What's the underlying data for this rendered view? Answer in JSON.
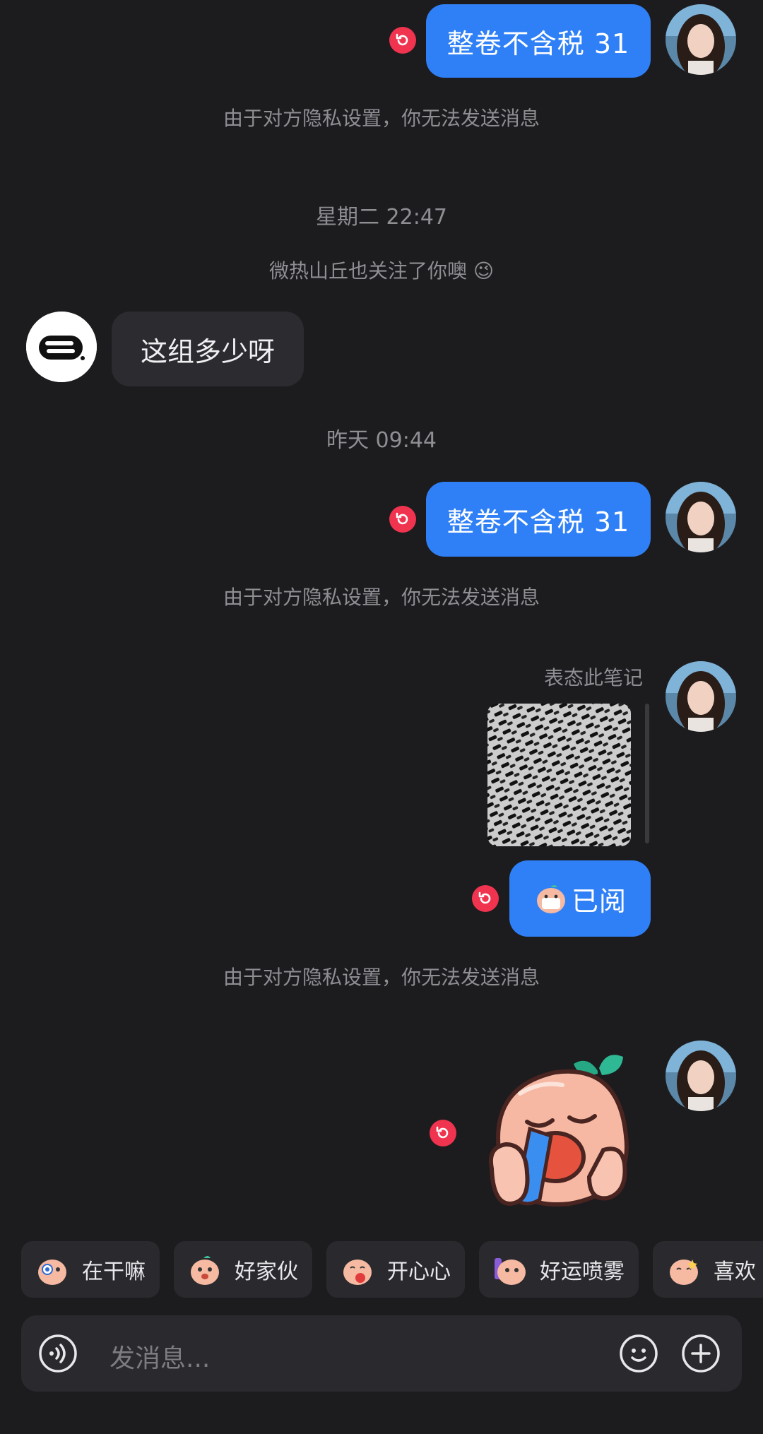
{
  "messages": {
    "msg1_text": "整卷不含税 31",
    "privacy_notice_1": "由于对方隐私设置，你无法发送消息",
    "time_1": "星期二 22:47",
    "follow_notice": "微热山丘也关注了你噢",
    "follow_emoji": "😉",
    "incoming_text": "这组多少呀",
    "time_2": "昨天 09:44",
    "msg2_text": "整卷不含税 31",
    "privacy_notice_2": "由于对方隐私设置，你无法发送消息",
    "note_reaction_label": "表态此笔记",
    "read_text": "已阅",
    "privacy_notice_3": "由于对方隐私设置，你无法发送消息"
  },
  "quick_replies": [
    {
      "label": "在干嘛"
    },
    {
      "label": "好家伙"
    },
    {
      "label": "开心心"
    },
    {
      "label": "好运喷雾"
    },
    {
      "label": "喜欢"
    }
  ],
  "composer": {
    "placeholder": "发消息..."
  },
  "icons": {
    "voice": "voice-icon",
    "emoji": "emoji-icon",
    "plus": "plus-icon",
    "retract": "retract-icon"
  },
  "colors": {
    "background": "#1c1c1f",
    "outgoing_bubble": "#2f80f6",
    "incoming_bubble": "#2c2c30",
    "retract_badge": "#f0334e"
  }
}
